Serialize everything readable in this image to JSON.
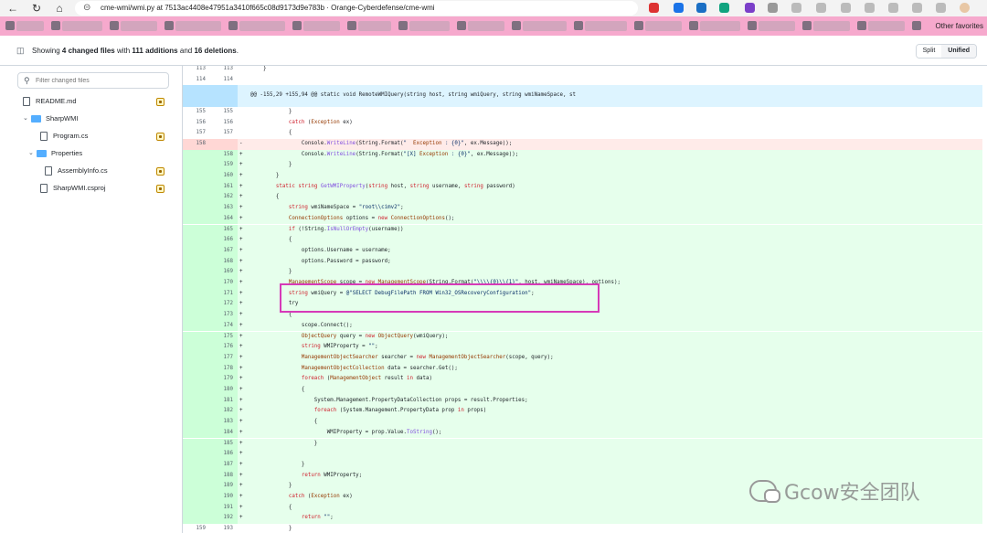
{
  "browser": {
    "url": "cme-wmi/wmi.py at 7513ac4408e47951a3410f665c08d9173d9e783b · Orange-Cyberdefense/cme-wmi",
    "bookmarks_other": "Other favorites"
  },
  "summary": {
    "prefix": "Showing ",
    "changed": "4 changed files",
    "mid1": " with ",
    "additions": "111 additions",
    "mid2": " and ",
    "deletions": "16 deletions",
    "suffix": "."
  },
  "view_toggle": {
    "split": "Split",
    "unified": "Unified"
  },
  "filter": {
    "placeholder": "Filter changed files"
  },
  "file_tree": [
    {
      "label": "README.md",
      "type": "file",
      "status": "modified"
    },
    {
      "label": "SharpWMI",
      "type": "folder"
    },
    {
      "label": "Program.cs",
      "type": "file",
      "status": "modified"
    },
    {
      "label": "Properties",
      "type": "folder"
    },
    {
      "label": "AssemblyInfo.cs",
      "type": "file",
      "status": "modified"
    },
    {
      "label": "SharpWMI.csproj",
      "type": "file",
      "status": "modified"
    }
  ],
  "diff": [
    {
      "kind": "ctx",
      "old": "113",
      "new": "113",
      "mark": "",
      "code": "    }"
    },
    {
      "kind": "ctx",
      "old": "114",
      "new": "114",
      "mark": "",
      "code": ""
    },
    {
      "kind": "hunk",
      "old": "",
      "new": "",
      "mark": "",
      "code": "@@ -155,29 +155,94 @@ static void RemoteWMIQuery(string host, string wmiQuery, string wmiNameSpace, st"
    },
    {
      "kind": "ctx",
      "old": "155",
      "new": "155",
      "mark": "",
      "code": "            }"
    },
    {
      "kind": "ctx",
      "old": "156",
      "new": "156",
      "mark": "",
      "code": "            catch (Exception ex)"
    },
    {
      "kind": "ctx",
      "old": "157",
      "new": "157",
      "mark": "",
      "code": "            {"
    },
    {
      "kind": "del",
      "old": "158",
      "new": "",
      "mark": "-",
      "code": "                Console.WriteLine(String.Format(\"  Exception : {0}\", ex.Message));"
    },
    {
      "kind": "add",
      "old": "",
      "new": "158",
      "mark": "+",
      "code": "                Console.WriteLine(String.Format(\"[X] Exception : {0}\", ex.Message));"
    },
    {
      "kind": "add",
      "old": "",
      "new": "159",
      "mark": "+",
      "code": "            }"
    },
    {
      "kind": "add",
      "old": "",
      "new": "160",
      "mark": "+",
      "code": "        }"
    },
    {
      "kind": "add",
      "old": "",
      "new": "161",
      "mark": "+",
      "code": "        static string GetWMIProperty(string host, string username, string password)"
    },
    {
      "kind": "add",
      "old": "",
      "new": "162",
      "mark": "+",
      "code": "        {"
    },
    {
      "kind": "add",
      "old": "",
      "new": "163",
      "mark": "+",
      "code": "            string wmiNameSpace = \"root\\\\cimv2\";"
    },
    {
      "kind": "add",
      "old": "",
      "new": "164",
      "mark": "+",
      "code": "            ConnectionOptions options = new ConnectionOptions();"
    },
    {
      "kind": "add",
      "old": "",
      "new": "165",
      "mark": "+",
      "code": "            if (!String.IsNullOrEmpty(username))"
    },
    {
      "kind": "add",
      "old": "",
      "new": "166",
      "mark": "+",
      "code": "            {"
    },
    {
      "kind": "add",
      "old": "",
      "new": "167",
      "mark": "+",
      "code": "                options.Username = username;"
    },
    {
      "kind": "add",
      "old": "",
      "new": "168",
      "mark": "+",
      "code": "                options.Password = password;"
    },
    {
      "kind": "add",
      "old": "",
      "new": "169",
      "mark": "+",
      "code": "            }"
    },
    {
      "kind": "add",
      "old": "",
      "new": "170",
      "mark": "+",
      "code": "            ManagementScope scope = new ManagementScope(String.Format(\"\\\\\\\\{0}\\\\{1}\", host, wmiNameSpace), options);"
    },
    {
      "kind": "add",
      "old": "",
      "new": "171",
      "mark": "+",
      "code": "            string wmiQuery = @\"SELECT DebugFilePath FROM Win32_OSRecoveryConfiguration\";"
    },
    {
      "kind": "add",
      "old": "",
      "new": "172",
      "mark": "+",
      "code": "            try"
    },
    {
      "kind": "add",
      "old": "",
      "new": "173",
      "mark": "+",
      "code": "            {"
    },
    {
      "kind": "add",
      "old": "",
      "new": "174",
      "mark": "+",
      "code": "                scope.Connect();"
    },
    {
      "kind": "add",
      "old": "",
      "new": "175",
      "mark": "+",
      "code": "                ObjectQuery query = new ObjectQuery(wmiQuery);"
    },
    {
      "kind": "add",
      "old": "",
      "new": "176",
      "mark": "+",
      "code": "                string WMIProperty = \"\";"
    },
    {
      "kind": "add",
      "old": "",
      "new": "177",
      "mark": "+",
      "code": "                ManagementObjectSearcher searcher = new ManagementObjectSearcher(scope, query);"
    },
    {
      "kind": "add",
      "old": "",
      "new": "178",
      "mark": "+",
      "code": "                ManagementObjectCollection data = searcher.Get();"
    },
    {
      "kind": "add",
      "old": "",
      "new": "179",
      "mark": "+",
      "code": "                foreach (ManagementObject result in data)"
    },
    {
      "kind": "add",
      "old": "",
      "new": "180",
      "mark": "+",
      "code": "                {"
    },
    {
      "kind": "add",
      "old": "",
      "new": "181",
      "mark": "+",
      "code": "                    System.Management.PropertyDataCollection props = result.Properties;"
    },
    {
      "kind": "add",
      "old": "",
      "new": "182",
      "mark": "+",
      "code": "                    foreach (System.Management.PropertyData prop in props)"
    },
    {
      "kind": "add",
      "old": "",
      "new": "183",
      "mark": "+",
      "code": "                    {"
    },
    {
      "kind": "add",
      "old": "",
      "new": "184",
      "mark": "+",
      "code": "                        WMIProperty = prop.Value.ToString();"
    },
    {
      "kind": "add",
      "old": "",
      "new": "185",
      "mark": "+",
      "code": "                    }"
    },
    {
      "kind": "add",
      "old": "",
      "new": "186",
      "mark": "+",
      "code": ""
    },
    {
      "kind": "add",
      "old": "",
      "new": "187",
      "mark": "+",
      "code": "                }"
    },
    {
      "kind": "add",
      "old": "",
      "new": "188",
      "mark": "+",
      "code": "                return WMIProperty;"
    },
    {
      "kind": "add",
      "old": "",
      "new": "189",
      "mark": "+",
      "code": "            }"
    },
    {
      "kind": "add",
      "old": "",
      "new": "190",
      "mark": "+",
      "code": "            catch (Exception ex)"
    },
    {
      "kind": "add",
      "old": "",
      "new": "191",
      "mark": "+",
      "code": "            {"
    },
    {
      "kind": "add",
      "old": "",
      "new": "192",
      "mark": "+",
      "code": "                return \"\";"
    },
    {
      "kind": "ctx",
      "old": "159",
      "new": "193",
      "mark": "",
      "code": "            }"
    }
  ],
  "watermark": {
    "text": "Gcow安全团队"
  },
  "colors": {
    "addition_bg": "#e6ffec",
    "deletion_bg": "#ffebe9",
    "hunk_bg": "#ddf4ff",
    "highlight_box": "#d63ab8",
    "bookmark_bar": "#f6a9cd"
  }
}
